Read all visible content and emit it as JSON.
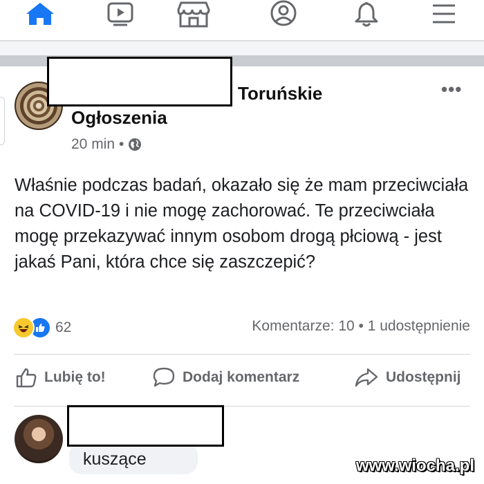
{
  "nav": {
    "tabs": [
      {
        "icon": "home-icon",
        "active": true
      },
      {
        "icon": "video-icon",
        "active": false
      },
      {
        "icon": "marketplace-icon",
        "active": false
      },
      {
        "icon": "profile-icon",
        "active": false
      },
      {
        "icon": "bell-icon",
        "active": false
      },
      {
        "icon": "menu-icon",
        "active": false
      }
    ],
    "active_color": "#1877f2",
    "inactive_color": "#65676b"
  },
  "post": {
    "page_name_part1": "Toruńskie",
    "page_name_part2": "Ogłoszenia",
    "time": "20 min",
    "separator": "•",
    "privacy_icon": "globe-icon",
    "more_label": "•••",
    "text": "Właśnie podczas badań, okazało się że mam przeciwciała na COVID-19 i nie mogę zachorować. Te przeciwciała mogę przekazywać innym osobom drogą płciową - jest jakaś Pani, która chce się zaszczepić?",
    "reactions": {
      "icons": [
        "haha-icon",
        "like-icon"
      ],
      "count": "62"
    },
    "stats": "Komentarze: 10 • 1 udostępnienie"
  },
  "actions": {
    "like": "Lubię to!",
    "comment": "Dodaj komentarz",
    "share": "Udostępnij"
  },
  "comment": {
    "text": "kuszące"
  },
  "watermark": "www.wiocha.pl"
}
